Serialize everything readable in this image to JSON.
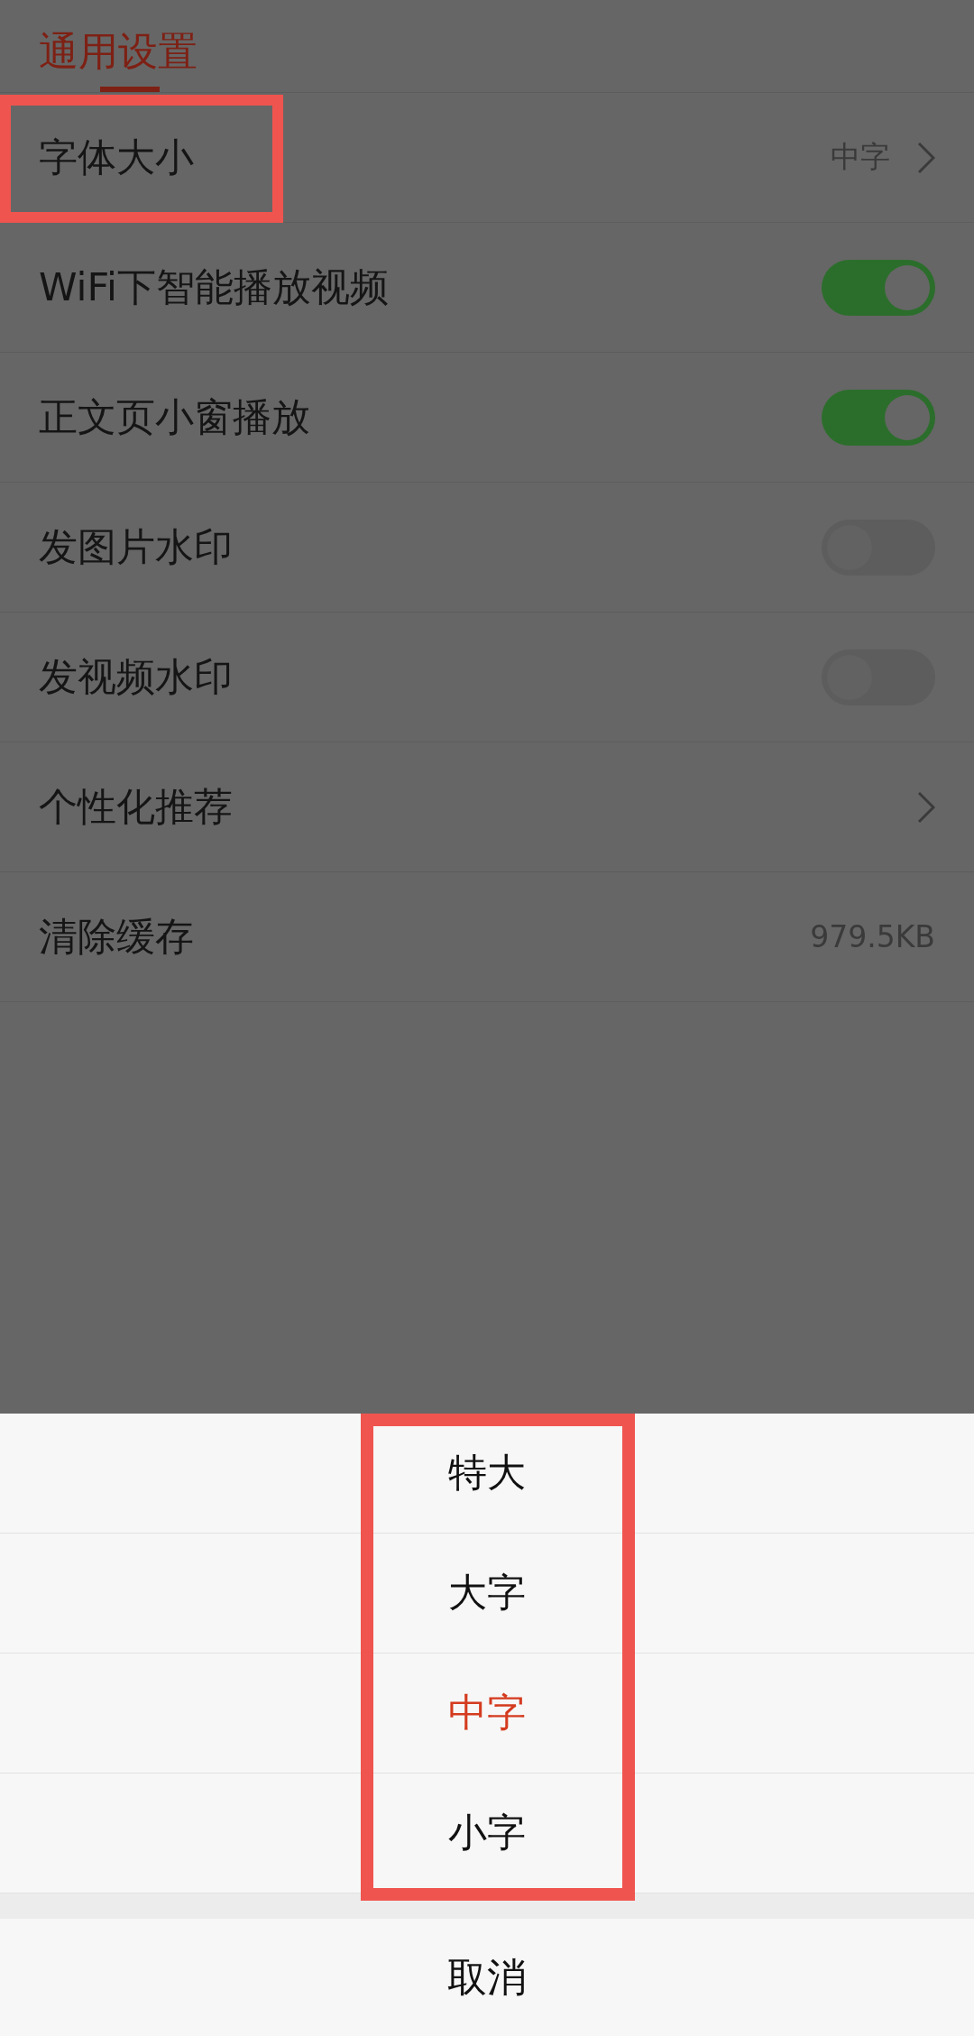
{
  "header": {
    "tab": {
      "label": "通用设置",
      "selected": true
    }
  },
  "settings": [
    {
      "kind": "link",
      "label": "字体大小",
      "value": "中字",
      "highlighted": true
    },
    {
      "kind": "toggle",
      "label": "WiFi下智能播放视频",
      "on": true
    },
    {
      "kind": "toggle",
      "label": "正文页小窗播放",
      "on": true
    },
    {
      "kind": "toggle",
      "label": "发图片水印",
      "on": false
    },
    {
      "kind": "toggle",
      "label": "发视频水印",
      "on": false
    },
    {
      "kind": "link",
      "label": "个性化推荐"
    },
    {
      "kind": "info",
      "label": "清除缓存",
      "value": "979.5KB"
    }
  ],
  "sheet": {
    "highlighted": true,
    "options": [
      {
        "label": "特大",
        "selected": false
      },
      {
        "label": "大字",
        "selected": false
      },
      {
        "label": "中字",
        "selected": true
      },
      {
        "label": "小字",
        "selected": false
      }
    ],
    "cancel": "取消"
  }
}
